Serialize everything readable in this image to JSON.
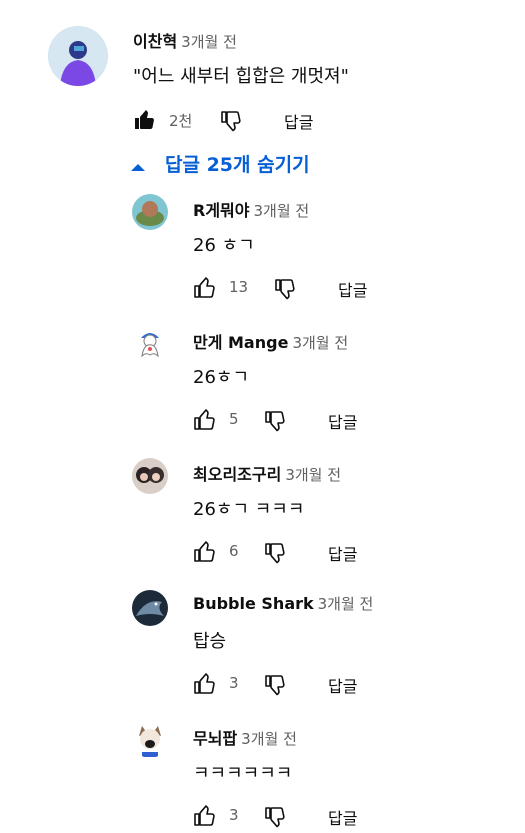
{
  "top_comment": {
    "author": "이찬혁",
    "time": "3개월 전",
    "text": "\"어느 새부터 힙합은 개멋져\"",
    "likes": "2천",
    "reply_label": "답글"
  },
  "replies_toggle": {
    "label": "답글 25개 숨기기",
    "icon": "caret-up-icon"
  },
  "replies": [
    {
      "author": "R게뭐야",
      "time": "3개월 전",
      "text": "26 ㅎㄱ",
      "likes": "13",
      "reply_label": "답글"
    },
    {
      "author": "만게 Mange",
      "time": "3개월 전",
      "text": "26ㅎㄱ",
      "likes": "5",
      "reply_label": "답글"
    },
    {
      "author": "최오리조구리",
      "time": "3개월 전",
      "text": "26ㅎㄱ ㅋㅋㅋ",
      "likes": "6",
      "reply_label": "답글"
    },
    {
      "author": "Bubble Shark",
      "time": "3개월 전",
      "text": "탑승",
      "likes": "3",
      "reply_label": "답글"
    },
    {
      "author": "무뇌팝",
      "time": "3개월 전",
      "text": "ㅋㅋㅋㅋㅋㅋ",
      "likes": "3",
      "reply_label": "답글"
    }
  ],
  "colors": {
    "link_blue": "#065fd4",
    "secondary_text": "#606060",
    "primary_text": "#0f0f0f"
  }
}
